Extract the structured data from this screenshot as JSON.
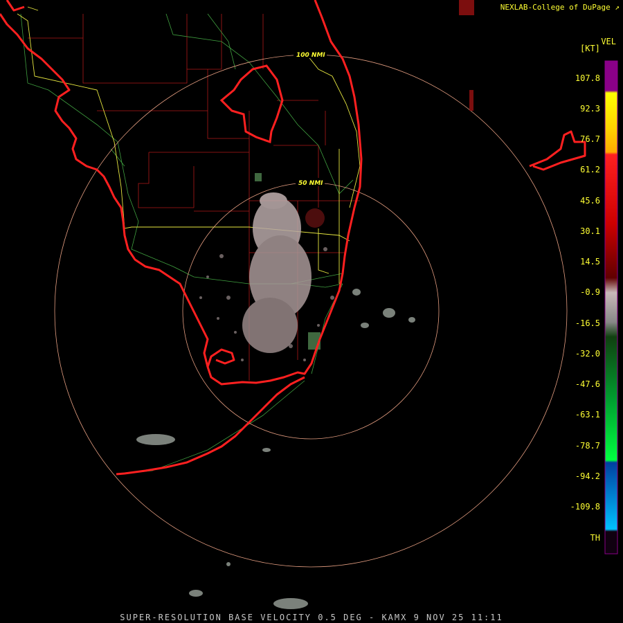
{
  "credit": "NEXLAB-College of DuPage",
  "credit_icon": "external-link-icon",
  "legend": {
    "product": "VEL",
    "unit": "[KT]",
    "ticks": [
      "107.8",
      "92.3",
      "76.7",
      "61.2",
      "45.6",
      "30.1",
      "14.5",
      "-0.9",
      "-16.5",
      "-32.0",
      "-47.6",
      "-63.1",
      "-78.7",
      "-94.2",
      "-109.8",
      "TH"
    ],
    "colors": [
      "#8a0088",
      "#ff2020",
      "#ffff00",
      "#c00000",
      "#5a0000",
      "#aaaaaa",
      "#2a8a2a",
      "#00ff40",
      "#0060c0",
      "#00b0ff",
      "#200020"
    ]
  },
  "range_rings": [
    "100 NMI",
    "50 NMI"
  ],
  "caption": "SUPER-RESOLUTION BASE VELOCITY 0.5 DEG - KAMX 9 NOV 25 11:11",
  "map_colors": {
    "coastline": "#ff2020",
    "county_lines": "#b01818",
    "highways": "#40a040",
    "cwa_border": "#e8e840",
    "rings": "#ffb090"
  }
}
